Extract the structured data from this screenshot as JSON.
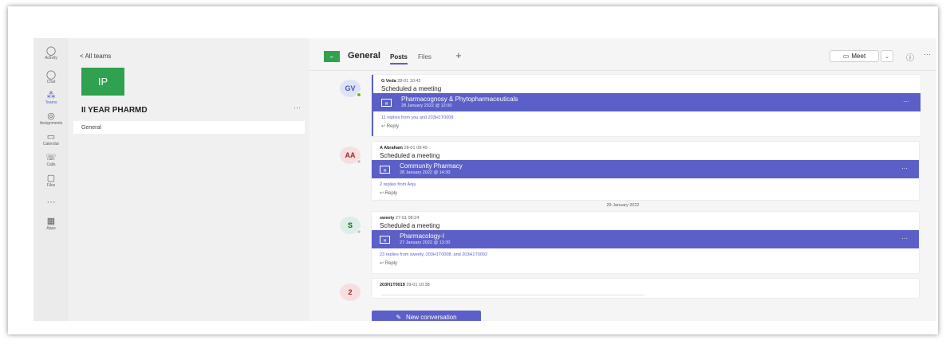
{
  "rail": {
    "items": [
      {
        "icon": "bell-icon",
        "glyph": "🔔",
        "label": "Activity"
      },
      {
        "icon": "chat-icon",
        "glyph": "💬",
        "label": "Chat"
      },
      {
        "icon": "teams-icon",
        "glyph": "👥",
        "label": "Teams"
      },
      {
        "icon": "assignments-icon",
        "glyph": "📋",
        "label": "Assignments"
      },
      {
        "icon": "calendar-icon",
        "glyph": "📅",
        "label": "Calendar"
      },
      {
        "icon": "calls-icon",
        "glyph": "📞",
        "label": "Calls"
      },
      {
        "icon": "files-icon",
        "glyph": "📄",
        "label": "Files"
      },
      {
        "icon": "more-icon",
        "glyph": "···",
        "label": ""
      },
      {
        "icon": "apps-icon",
        "glyph": "▦",
        "label": "Apps"
      }
    ]
  },
  "team": {
    "back_label": "< All teams",
    "avatar_text": "IP",
    "name": "II YEAR PHARMD",
    "more": "···",
    "channel": "General"
  },
  "header": {
    "channel_avatar": "IP",
    "channel_name": "General",
    "tabs": [
      "Posts",
      "Files"
    ],
    "add_tab": "+",
    "meet_label": "Meet",
    "meet_icon": "video-icon",
    "dropdown": "⌄",
    "info": "ⓘ",
    "more": "···"
  },
  "posts": [
    {
      "initials": "GV",
      "avatar_color": "#dde2f7",
      "initials_color": "#4f52b2",
      "status_color": "#6bb700",
      "author": "G Veda",
      "time": "28-01 10:42",
      "subject": "Scheduled a meeting",
      "meeting_title": "Pharmacognosy & Phytopharmaceuticals",
      "meeting_date": "28 January 2022 @ 12:00",
      "replies": "11 replies from you and 203H1T0008",
      "reply": "Reply"
    },
    {
      "initials": "AA",
      "avatar_color": "#f8dedf",
      "initials_color": "#a4262c",
      "status_color": "#c8c8c8",
      "author": "A Abraham",
      "time": "28-01 09:49",
      "subject": "Scheduled a meeting",
      "meeting_title": "Community Pharmacy",
      "meeting_date": "28 January 2022 @ 14:30",
      "replies": "2 replies from Anju",
      "reply": "Reply"
    },
    {
      "initials": "S",
      "avatar_color": "#dbeee7",
      "initials_color": "#0b6a0b",
      "status_color": "#c8c8c8",
      "author": "sweety",
      "time": "27-01 08:24",
      "subject": "Scheduled a meeting",
      "meeting_title": "Pharmacology-I",
      "meeting_date": "27 January 2022 @ 13:30",
      "replies": "23 replies from sweety, 203H1T0008, and 203H1T0002",
      "reply": "Reply"
    }
  ],
  "date_separator": "29 January 2022",
  "last_post": {
    "initials": "2",
    "avatar_color": "#f8dedf",
    "initials_color": "#a4262c",
    "author": "203H1T0019",
    "time": "29-01 10:38"
  },
  "new_conversation": {
    "icon": "compose-icon",
    "label": "New conversation"
  },
  "colors": {
    "accent": "#5b5fc7",
    "team_green": "#30a14e"
  }
}
